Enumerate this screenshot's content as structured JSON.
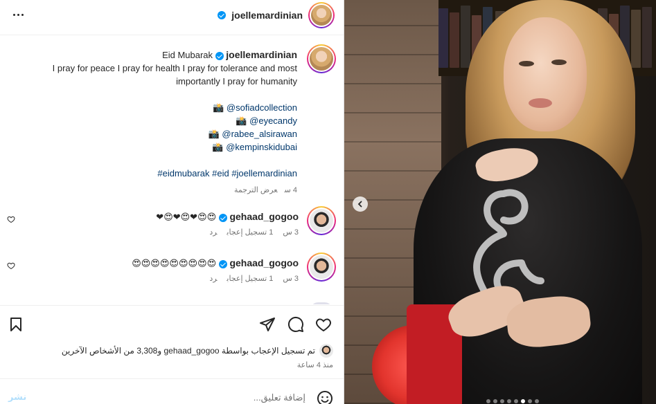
{
  "header": {
    "username": "joellemardinian",
    "more_label": "More options"
  },
  "caption": {
    "username": "joellemardinian",
    "title_prefix": "Eid Mubarak",
    "line1": "I pray for peace I pray for health I pray for tolerance and most",
    "line2": "importantly I pray for humanity",
    "mentions": [
      "@sofiadcollection",
      "@eyecandy",
      "@rabee_alsirawan",
      "@kempinskidubai"
    ],
    "mention_prefix": "📸",
    "hashtags": "#eidmubarak #eid #joellemardinian",
    "time": "4 س",
    "translate": "عرض الترجمة"
  },
  "comments": [
    {
      "username": "gehaad_gogoo",
      "text": "❤😍❤😍❤😍😍",
      "time": "3 س",
      "likes": "1 تسجيل إعجاب",
      "reply": "رد"
    },
    {
      "username": "gehaad_gogoo",
      "text": "😍😍😍😍😍😍😍😍😍",
      "time": "3 س",
      "likes": "1 تسجيل إعجاب",
      "reply": "رد"
    }
  ],
  "actions": {
    "likes_text": "تم تسجيل الإعجاب بواسطة gehaad_gogoo و3,308 من الأشخاص الآخرين",
    "time_ago": "منذ 4 ساعة"
  },
  "composer": {
    "placeholder": "إضافة تعليق...",
    "post_label": "نشر"
  },
  "carousel": {
    "slide_count": 8,
    "active_index": 5
  },
  "colors": {
    "link": "#00376b",
    "verified": "#0095f6",
    "post_disabled": "#b2dffc"
  }
}
